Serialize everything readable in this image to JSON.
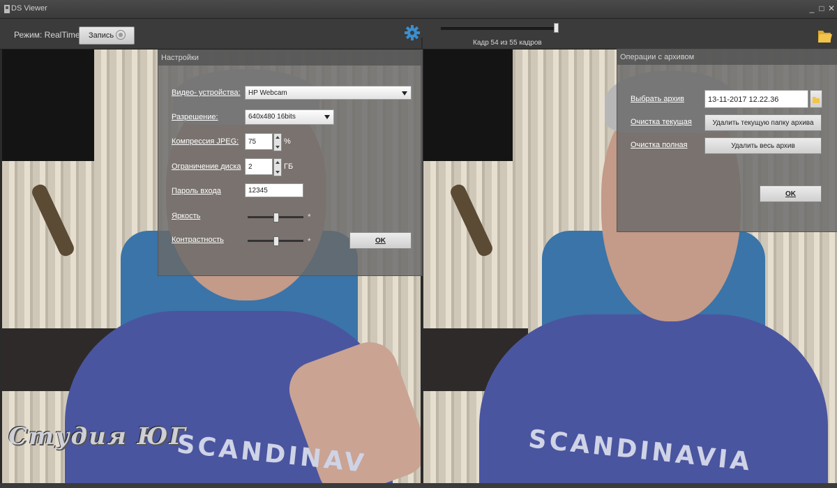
{
  "window": {
    "title": "DS Viewer",
    "minimize": "_",
    "maximize": "□",
    "close": "✕"
  },
  "toolbar": {
    "mode_label": "Режим: RealTime",
    "record_label": "Запись",
    "frame_label": "Кадр 54 из 55 кадров",
    "frame_position": 0.98
  },
  "settings": {
    "title": "Настройки",
    "video_device_label": "Видео- устройства:",
    "video_device_value": "HP Webcam",
    "resolution_label": "Разрешение:",
    "resolution_value": "640x480 16bits",
    "jpeg_label": "Компрессия JPEG:",
    "jpeg_value": "75",
    "jpeg_unit": "%",
    "disk_label": "Ограничение диска",
    "disk_value": "2",
    "disk_unit": "ГБ",
    "password_label": "Пароль входа",
    "password_value": "12345",
    "brightness_label": "Яркость",
    "brightness_level": 0.5,
    "contrast_label": "Контрастность",
    "contrast_level": 0.5,
    "star": "*",
    "ok_label": "OK"
  },
  "archive": {
    "title": "Операции с архивом",
    "select_label": "Выбрать архив",
    "select_value": "13-11-2017 12.22.36",
    "clear_current_label": "Очистка текущая",
    "clear_current_button": "Удалить текущую папку архива",
    "clear_full_label": "Очистка полная",
    "clear_full_button": "Удалить весь архив",
    "ok_label": "OK"
  },
  "video": {
    "shirt_text_left": "SCANDINAV",
    "shirt_text_right": "SCANDINAVIA",
    "watermark": "Студия ЮГ"
  },
  "colors": {
    "accent": "#3a8fd0",
    "folder": "#f2c44c"
  }
}
